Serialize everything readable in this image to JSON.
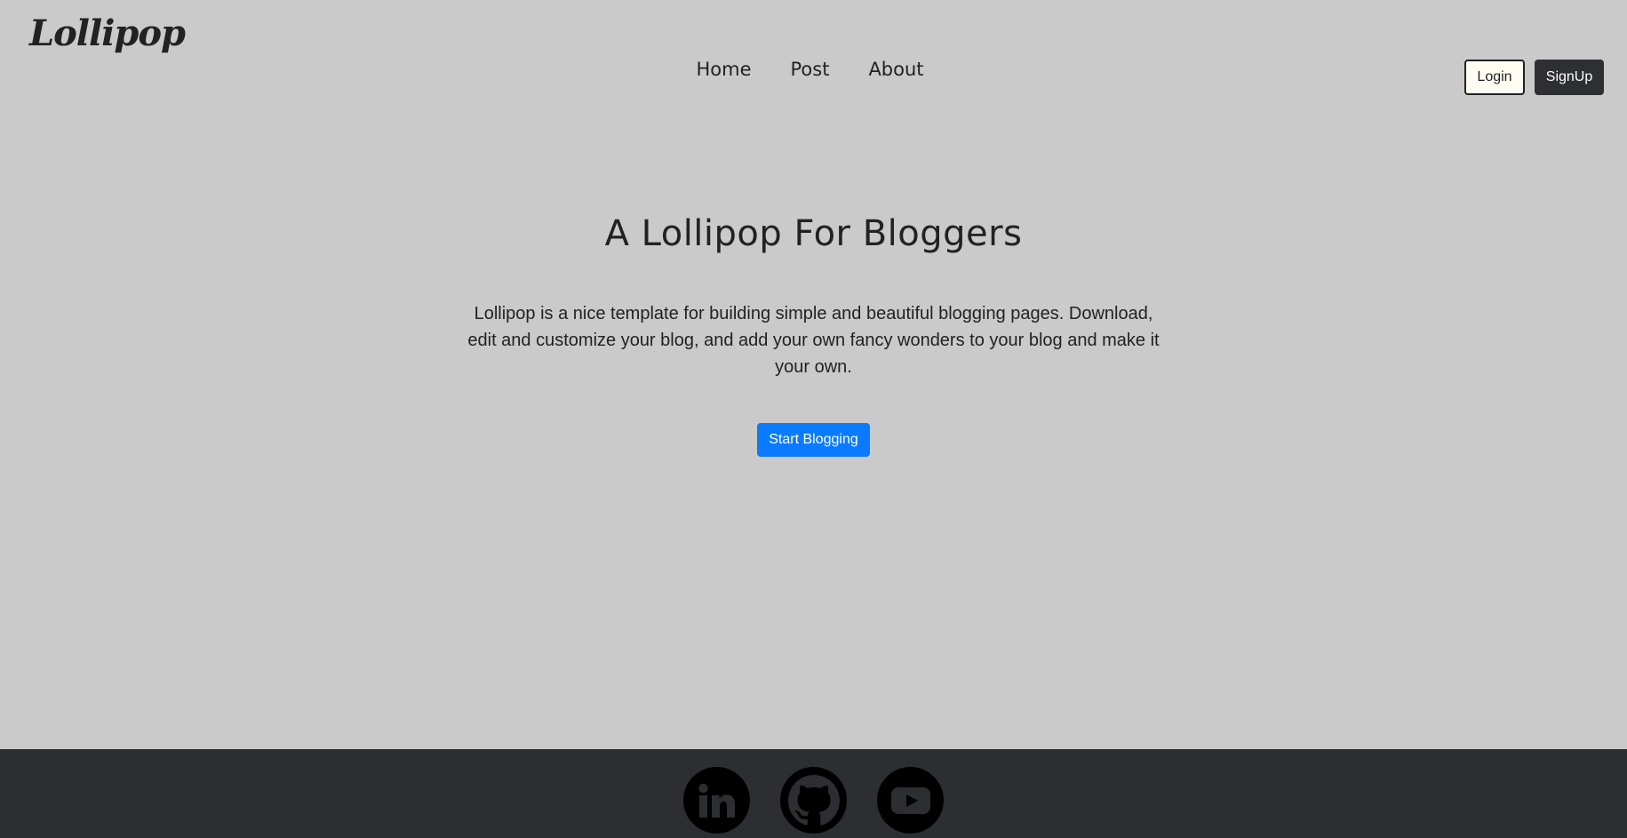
{
  "header": {
    "logo": "Lollipop",
    "nav": [
      "Home",
      "Post",
      "About"
    ],
    "login_label": "Login",
    "signup_label": "SignUp"
  },
  "hero": {
    "title": "A Lollipop For Bloggers",
    "lead": "Lollipop is a nice template for building simple and beautiful blogging pages. Download, edit and customize your blog, and add your own fancy wonders to your blog and make it your own.",
    "cta_label": "Start Blogging"
  },
  "footer": {
    "social_icons": [
      "linkedin-icon",
      "github-icon",
      "youtube-icon"
    ]
  },
  "colors": {
    "background": "#cacaca",
    "footer": "#2d2e31",
    "primary": "#0a7bff",
    "signup": "#2e2f33",
    "login": "#fffdf3"
  }
}
